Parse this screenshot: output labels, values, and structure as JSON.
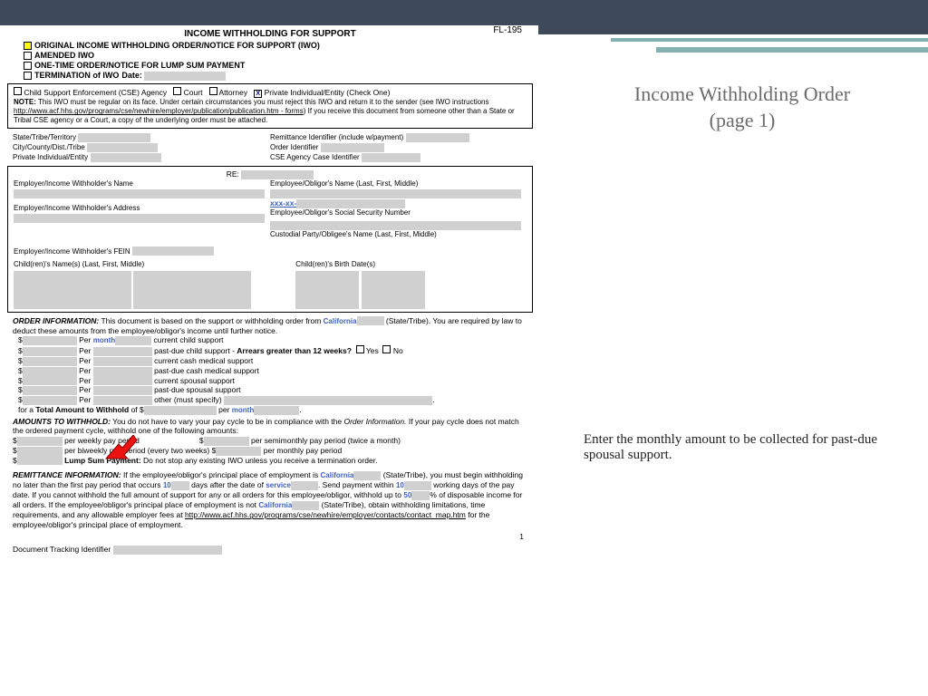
{
  "form": {
    "code": "FL-195",
    "title": "INCOME WITHHOLDING FOR SUPPORT",
    "options": {
      "o1": "ORIGINAL INCOME WITHHOLDING ORDER/NOTICE FOR SUPPORT (IWO)",
      "o2": "AMENDED IWO",
      "o3": "ONE-TIME ORDER/NOTICE FOR LUMP SUM PAYMENT",
      "o4": "TERMINATION of IWO"
    },
    "datelbl": "Date:",
    "row2": {
      "a": "Child Support Enforcement (CSE) Agency",
      "b": "Court",
      "c": "Attorney",
      "d": "Private Individual/Entity   (Check One)"
    },
    "note": "NOTE:",
    "notetext": " This IWO must be regular on its face. Under certain circumstances you must reject this IWO and return it to the sender (see IWO instructions ",
    "notelink": "http://www.acf.hhs.gov/programs/cse/newhire/employer/publication/publication.htm - forms",
    "notetext2": ") If you receive this document from someone other than a State or Tribal CSE agency or a Court, a copy of the underlying order must be attached.",
    "ids": {
      "a1": "State/Tribe/Territory",
      "a2": "Remittance Identifier (include w/payment)",
      "b1": "City/County/Dist./Tribe",
      "b2": "Order Identifier",
      "c1": "Private Individual/Entity",
      "c2": "CSE Agency Case Identifier"
    },
    "parties": {
      "re": "RE:",
      "p1": "Employer/Income Withholder's Name",
      "p2": "Employee/Obligor's Name (Last, First, Middle)",
      "ssn": "xxx-xx-",
      "p3": "Employer/Income Withholder's Address",
      "p4": "Employee/Obligor's Social Security Number",
      "p5": "Custodial Party/Obligee's Name (Last, First, Middle)",
      "p6": "Employer/Income Withholder's FEIN",
      "p7": "Child(ren)'s Name(s) (Last, First, Middle)",
      "p8": "Child(ren)'s Birth Date(s)"
    },
    "oi": {
      "h": "ORDER INFORMATION:",
      "t": " This document is based on the support or withholding order from ",
      "state": "California",
      "st": " (State/Tribe). You are required by law to deduct these amounts from the employee/obligor's income until further notice.",
      "per": "Per",
      "month": "month",
      "l1": "current child support",
      "l2": "past-due child support -  ",
      "arr": "Arrears greater than 12 weeks?",
      "yes": "Yes",
      "no": "No",
      "l3": "current cash medical support",
      "l4": "past-due cash medical support",
      "l5": "current spousal support",
      "l6": "past-due spousal support",
      "l7": "other (must specify)",
      "tot1": "for a ",
      "tot2": "Total Amount to Withhold",
      "tot3": " of $",
      "tot4": "per "
    },
    "aw": {
      "h": "AMOUNTS TO WITHHOLD:",
      "t": " You do not have to vary your pay cycle to be in compliance with the ",
      "oi": "Order Information.",
      "t2": " If your pay cycle does not match the ordered payment cycle, withhold one of the following amounts:",
      "a1": "per weekly pay period",
      "a2": "per semimonthly pay period (twice a month)",
      "a3": "per biweekly pay period (every two weeks) $",
      "a4": "per monthly pay period",
      "ls": "Lump Sum Payment:",
      "lst": " Do not stop any existing IWO unless you receive a termination order."
    },
    "ri": {
      "h": "REMITTANCE INFORMATION:",
      "t": " If the employee/obligor's principal place of employment is ",
      "state": "California",
      "st": " (State/Tribe), you must begin withholding no later than the first pay period that occurs",
      "d1": "10",
      "t2": " days after the date of ",
      "srv": "service",
      "t3": ". Send payment within ",
      "d2": "10",
      "t4": " working days of the pay date. If you cannot withhold the full amount of support for any or all orders for this employee/obligor, withhold up to ",
      "pct": "50",
      "t5": "% of disposable income for all orders. If the employee/obligor's principal place of employment is not ",
      "state2": "California",
      "t6": " (State/Tribe), obtain withholding limitations, time requirements, and any allowable employer fees at ",
      "link": "http://www.acf.hhs.gov/programs/cse/newhire/employer/contacts/contact_map.htm",
      "t7": " for the employee/obligor's principal place of employment."
    },
    "page": "1",
    "dti": "Document Tracking Identifier"
  },
  "side": {
    "title1": "Income Withholding Order",
    "title2": "(page 1)",
    "body": "Enter the monthly amount to be collected for past-due spousal support."
  }
}
